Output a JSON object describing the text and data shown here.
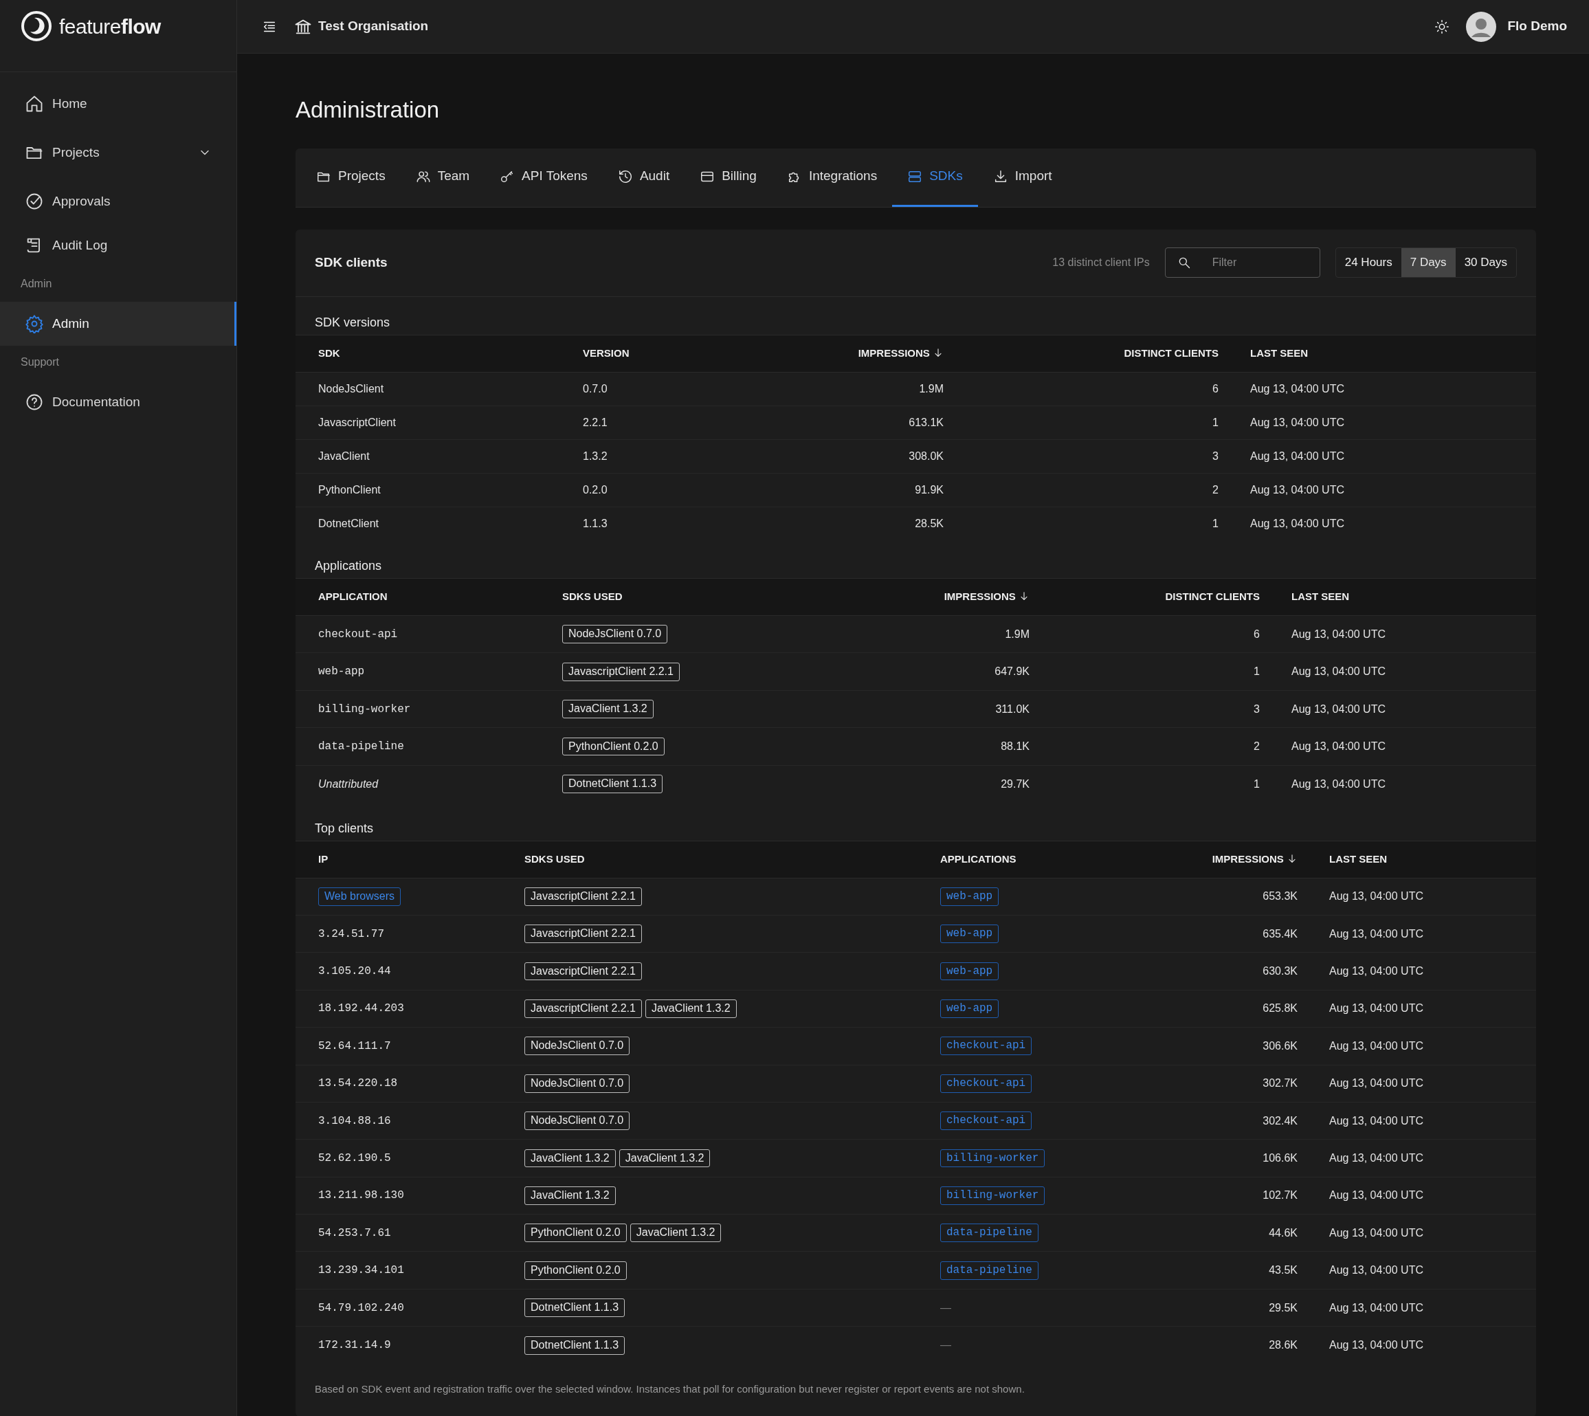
{
  "brand": "feature**flow**",
  "header": {
    "organisation": "Test Organisation",
    "user": "Flo Demo"
  },
  "sidebar": {
    "items": [
      {
        "kind": "link",
        "label": "Home",
        "selected": false
      },
      {
        "kind": "group",
        "label": "Projects",
        "selected": false
      },
      {
        "kind": "link",
        "label": "Approvals",
        "selected": false
      },
      {
        "kind": "link",
        "label": "Audit Log",
        "selected": false
      },
      {
        "kind": "section",
        "label": "Admin"
      },
      {
        "kind": "link",
        "label": "Admin",
        "selected": true
      },
      {
        "kind": "section",
        "label": "Support"
      },
      {
        "kind": "link",
        "label": "Documentation",
        "selected": false
      }
    ]
  },
  "page_title": "Administration",
  "tabs": [
    {
      "label": "Projects",
      "selected": false
    },
    {
      "label": "Team",
      "selected": false
    },
    {
      "label": "API Tokens",
      "selected": false
    },
    {
      "label": "Audit",
      "selected": false
    },
    {
      "label": "Billing",
      "selected": false
    },
    {
      "label": "Integrations",
      "selected": false
    },
    {
      "label": "SDKs",
      "selected": true
    },
    {
      "label": "Import",
      "selected": false
    }
  ],
  "sdk_clients": {
    "title": "SDK clients",
    "client_count": "13 distinct client IPs",
    "filter": {
      "placeholder": "Filter"
    },
    "ranges": [
      {
        "label": "24 Hours",
        "selected": false
      },
      {
        "label": "7 Days",
        "selected": true
      },
      {
        "label": "30 Days",
        "selected": false
      }
    ],
    "sdk_versions": {
      "title": "SDK versions",
      "columns": [
        {
          "label": "SDK",
          "sorted": false
        },
        {
          "label": "VERSION",
          "sorted": false
        },
        {
          "label": "IMPRESSIONS",
          "sorted": true
        },
        {
          "label": "DISTINCT CLIENTS",
          "sorted": false
        },
        {
          "label": "LAST SEEN",
          "sorted": false
        }
      ],
      "rows": [
        [
          "NodeJsClient",
          "0.7.0",
          "1.9M",
          "6",
          "Aug 13, 04:00 UTC"
        ],
        [
          "JavascriptClient",
          "2.2.1",
          "613.1K",
          "1",
          "Aug 13, 04:00 UTC"
        ],
        [
          "JavaClient",
          "1.3.2",
          "308.0K",
          "3",
          "Aug 13, 04:00 UTC"
        ],
        [
          "PythonClient",
          "0.2.0",
          "91.9K",
          "2",
          "Aug 13, 04:00 UTC"
        ],
        [
          "DotnetClient",
          "1.1.3",
          "28.5K",
          "1",
          "Aug 13, 04:00 UTC"
        ]
      ]
    },
    "applications": {
      "title": "Applications",
      "columns": [
        {
          "label": "APPLICATION",
          "sorted": false
        },
        {
          "label": "SDKS USED",
          "sorted": false
        },
        {
          "label": "IMPRESSIONS",
          "sorted": true
        },
        {
          "label": "DISTINCT CLIENTS",
          "sorted": false
        },
        {
          "label": "LAST SEEN",
          "sorted": false
        }
      ],
      "rows": [
        {
          "kind": "named",
          "application": "checkout-api",
          "sdks": [
            "NodeJsClient 0.7.0"
          ],
          "impressions": "1.9M",
          "distinct_clients": "6",
          "last_seen": "Aug 13, 04:00 UTC"
        },
        {
          "kind": "named",
          "application": "web-app",
          "sdks": [
            "JavascriptClient 2.2.1"
          ],
          "impressions": "647.9K",
          "distinct_clients": "1",
          "last_seen": "Aug 13, 04:00 UTC"
        },
        {
          "kind": "named",
          "application": "billing-worker",
          "sdks": [
            "JavaClient 1.3.2"
          ],
          "impressions": "311.0K",
          "distinct_clients": "3",
          "last_seen": "Aug 13, 04:00 UTC"
        },
        {
          "kind": "named",
          "application": "data-pipeline",
          "sdks": [
            "PythonClient 0.2.0"
          ],
          "impressions": "88.1K",
          "distinct_clients": "2",
          "last_seen": "Aug 13, 04:00 UTC"
        },
        {
          "kind": "unattributed",
          "application": "Unattributed",
          "sdks": [
            "DotnetClient 1.1.3"
          ],
          "impressions": "29.7K",
          "distinct_clients": "1",
          "last_seen": "Aug 13, 04:00 UTC"
        }
      ]
    },
    "top_clients": {
      "title": "Top clients",
      "columns": [
        {
          "label": "IP",
          "sorted": false
        },
        {
          "label": "SDKS USED",
          "sorted": false
        },
        {
          "label": "APPLICATIONS",
          "sorted": false
        },
        {
          "label": "IMPRESSIONS",
          "sorted": true
        },
        {
          "label": "LAST SEEN",
          "sorted": false
        }
      ],
      "rows": [
        {
          "kind": "group",
          "ip": "Web browsers",
          "sdks": [
            "JavascriptClient 2.2.1"
          ],
          "applications": [
            "web-app"
          ],
          "impressions": "653.3K",
          "last_seen": "Aug 13, 04:00 UTC"
        },
        {
          "kind": "ip",
          "ip": "3.24.51.77",
          "sdks": [
            "JavascriptClient 2.2.1"
          ],
          "applications": [
            "web-app"
          ],
          "impressions": "635.4K",
          "last_seen": "Aug 13, 04:00 UTC"
        },
        {
          "kind": "ip",
          "ip": "3.105.20.44",
          "sdks": [
            "JavascriptClient 2.2.1"
          ],
          "applications": [
            "web-app"
          ],
          "impressions": "630.3K",
          "last_seen": "Aug 13, 04:00 UTC"
        },
        {
          "kind": "ip",
          "ip": "18.192.44.203",
          "sdks": [
            "JavascriptClient 2.2.1",
            "JavaClient 1.3.2"
          ],
          "applications": [
            "web-app"
          ],
          "impressions": "625.8K",
          "last_seen": "Aug 13, 04:00 UTC"
        },
        {
          "kind": "ip",
          "ip": "52.64.111.7",
          "sdks": [
            "NodeJsClient 0.7.0"
          ],
          "applications": [
            "checkout-api"
          ],
          "impressions": "306.6K",
          "last_seen": "Aug 13, 04:00 UTC"
        },
        {
          "kind": "ip",
          "ip": "13.54.220.18",
          "sdks": [
            "NodeJsClient 0.7.0"
          ],
          "applications": [
            "checkout-api"
          ],
          "impressions": "302.7K",
          "last_seen": "Aug 13, 04:00 UTC"
        },
        {
          "kind": "ip",
          "ip": "3.104.88.16",
          "sdks": [
            "NodeJsClient 0.7.0"
          ],
          "applications": [
            "checkout-api"
          ],
          "impressions": "302.4K",
          "last_seen": "Aug 13, 04:00 UTC"
        },
        {
          "kind": "ip",
          "ip": "52.62.190.5",
          "sdks": [
            "JavaClient 1.3.2",
            "JavaClient 1.3.2"
          ],
          "applications": [
            "billing-worker"
          ],
          "impressions": "106.6K",
          "last_seen": "Aug 13, 04:00 UTC"
        },
        {
          "kind": "ip",
          "ip": "13.211.98.130",
          "sdks": [
            "JavaClient 1.3.2"
          ],
          "applications": [
            "billing-worker"
          ],
          "impressions": "102.7K",
          "last_seen": "Aug 13, 04:00 UTC"
        },
        {
          "kind": "ip",
          "ip": "54.253.7.61",
          "sdks": [
            "PythonClient 0.2.0",
            "JavaClient 1.3.2"
          ],
          "applications": [
            "data-pipeline"
          ],
          "impressions": "44.6K",
          "last_seen": "Aug 13, 04:00 UTC"
        },
        {
          "kind": "ip",
          "ip": "13.239.34.101",
          "sdks": [
            "PythonClient 0.2.0"
          ],
          "applications": [
            "data-pipeline"
          ],
          "impressions": "43.5K",
          "last_seen": "Aug 13, 04:00 UTC"
        },
        {
          "kind": "ip",
          "ip": "54.79.102.240",
          "sdks": [
            "DotnetClient 1.1.3"
          ],
          "applications": [],
          "no_application": "—",
          "impressions": "29.5K",
          "last_seen": "Aug 13, 04:00 UTC"
        },
        {
          "kind": "ip",
          "ip": "172.31.14.9",
          "sdks": [
            "DotnetClient 1.1.3"
          ],
          "applications": [],
          "no_application": "—",
          "impressions": "28.6K",
          "last_seen": "Aug 13, 04:00 UTC"
        }
      ]
    },
    "footnote": "Based on SDK event and registration traffic over the selected window. Instances that poll for configuration but never register or report events are not shown."
  }
}
